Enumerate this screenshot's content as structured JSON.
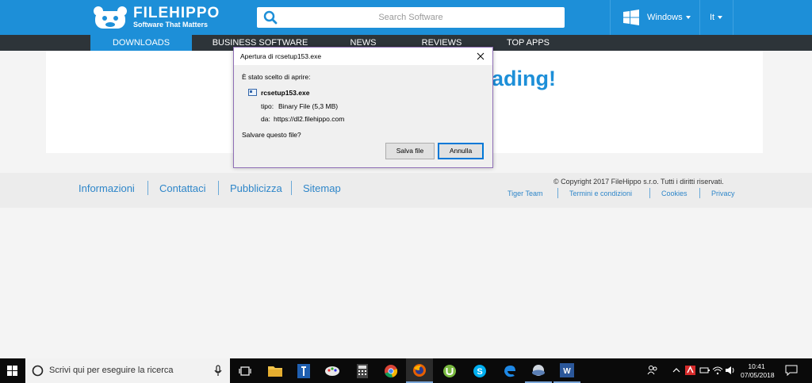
{
  "header": {
    "logo_title": "FILEHIPPO",
    "logo_tagline": "Software That Matters",
    "search_placeholder": "Search Software",
    "os_select": "Windows",
    "lang_select": "It"
  },
  "nav": {
    "items": [
      {
        "label": "DOWNLOADS",
        "active": true
      },
      {
        "label": "BUSINESS SOFTWARE",
        "active": false
      },
      {
        "label": "NEWS",
        "active": false
      },
      {
        "label": "REVIEWS",
        "active": false
      },
      {
        "label": "TOP APPS",
        "active": false
      }
    ]
  },
  "main": {
    "headline_visible": "ading!"
  },
  "footer": {
    "links": [
      "Informazioni",
      "Contattaci",
      "Pubblicizza",
      "Sitemap"
    ],
    "copyright": "© Copyright 2017 FileHippo s.r.o. Tutti i diritti riservati.",
    "secondary_links": [
      "Tiger Team",
      "Termini e condizioni",
      "Cookies",
      "Privacy"
    ]
  },
  "dialog": {
    "title": "Apertura di rcsetup153.exe",
    "intro": "È stato scelto di aprire:",
    "filename": "rcsetup153.exe",
    "type_label": "tipo:",
    "type_value": "Binary File (5,3 MB)",
    "from_label": "da:",
    "from_value": "https://dl2.filehippo.com",
    "question": "Salvare questo file?",
    "save_button": "Salva file",
    "cancel_button": "Annulla"
  },
  "taskbar": {
    "search_placeholder": "Scrivi qui per eseguire la ricerca",
    "time": "10:41",
    "date": "07/05/2018",
    "apps": [
      "task-view",
      "file-explorer",
      "app-blue",
      "paint",
      "calculator",
      "chrome",
      "firefox",
      "utorrent",
      "skype",
      "edge",
      "app-cloud",
      "word"
    ]
  },
  "colors": {
    "brand_blue": "#1d8fd8",
    "nav_dark": "#2d3439",
    "link_blue": "#2e86c9",
    "taskbar": "#0a0a0a"
  }
}
